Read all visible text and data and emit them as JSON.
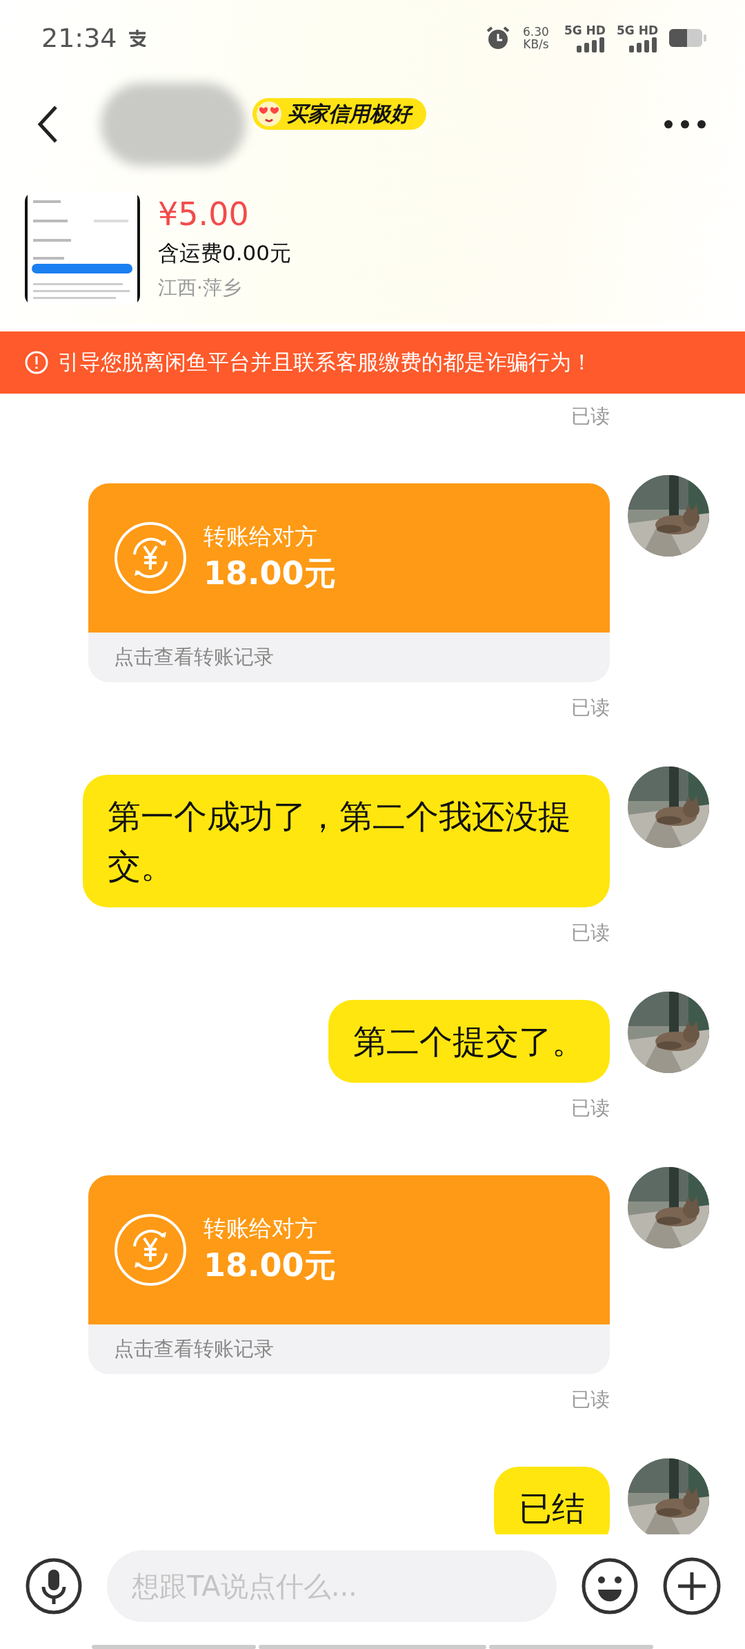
{
  "status_bar": {
    "time": "21:34",
    "network_speed": "6.30",
    "speed_unit": "KB/s",
    "sim_1": "5G HD",
    "sim_2": "5G HD"
  },
  "header": {
    "badge": "买家信用极好"
  },
  "product": {
    "price": "¥5.00",
    "shipping": "含运费0.00元",
    "location": "江西·萍乡"
  },
  "warning": "引导您脱离闲鱼平台并且联系客服缴费的都是诈骗行为！",
  "messages": [
    {
      "kind": "receipt",
      "read_label": "已读"
    },
    {
      "kind": "transfer",
      "title": "转账给对方",
      "amount": "18.00元",
      "footer": "点击查看转账记录",
      "read_label": "已读"
    },
    {
      "kind": "text",
      "text": "第一个成功了，第二个我还没提交。",
      "read_label": "已读"
    },
    {
      "kind": "text",
      "text": "第二个提交了。",
      "read_label": "已读"
    },
    {
      "kind": "transfer",
      "title": "转账给对方",
      "amount": "18.00元",
      "footer": "点击查看转账记录",
      "read_label": "已读"
    },
    {
      "kind": "text",
      "text": "已结"
    }
  ],
  "input": {
    "placeholder": "想跟TA说点什么..."
  }
}
